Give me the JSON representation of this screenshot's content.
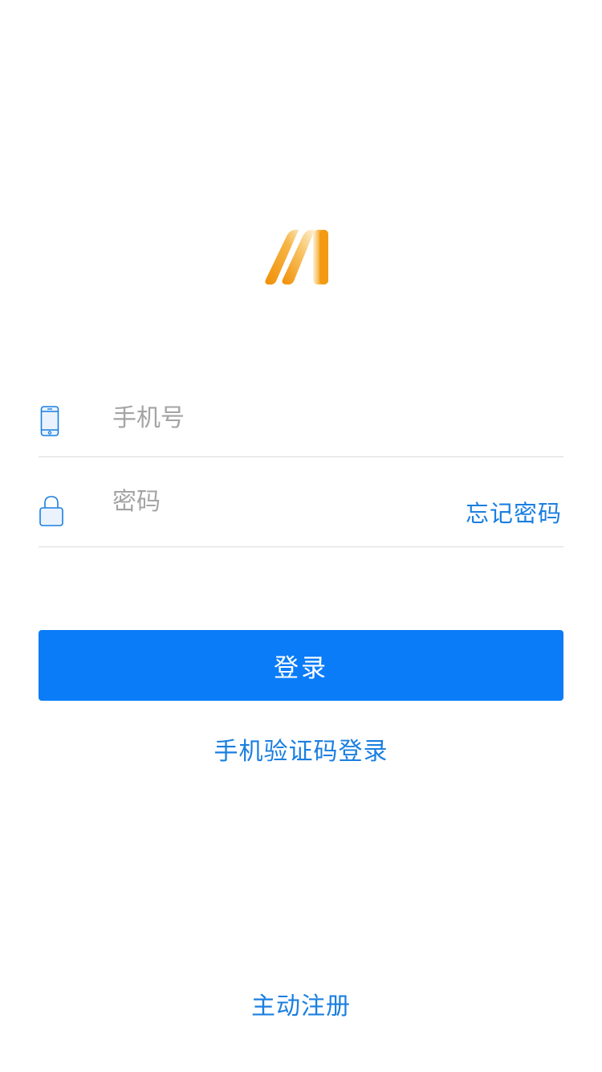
{
  "logo": {
    "icon": "app-logo-icon",
    "colors": [
      "#f29b12",
      "#f7c870",
      "#fbe6bf"
    ]
  },
  "phone_field": {
    "icon": "phone-icon",
    "placeholder": "手机号",
    "value": ""
  },
  "password_field": {
    "icon": "lock-icon",
    "placeholder": "密码",
    "value": "",
    "forgot_label": "忘记密码"
  },
  "login_button": {
    "label": "登录",
    "color": "#0a7cf8"
  },
  "sms_login_label": "手机验证码登录",
  "register_label": "主动注册",
  "colors": {
    "accent": "#1b7fe0",
    "placeholder": "#a4a4a4",
    "divider": "#dadada"
  }
}
